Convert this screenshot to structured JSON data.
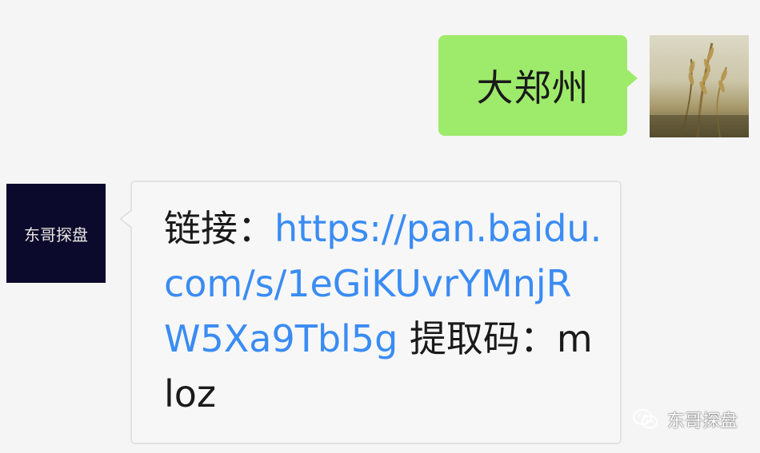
{
  "outgoing": {
    "text": "大郑州",
    "bubble_color": "#9eea6a"
  },
  "incoming": {
    "avatar_text": "东哥探盘",
    "label": "链接：",
    "link": "https://pan.baidu.com/s/1eGiKUvrYMnjRW5Xa9Tbl5g",
    "code_label": " 提取码：",
    "code": "mloz",
    "link_color": "#3a8cf3"
  },
  "watermark": {
    "icon": "wechat-icon",
    "text": "东哥探盘"
  }
}
